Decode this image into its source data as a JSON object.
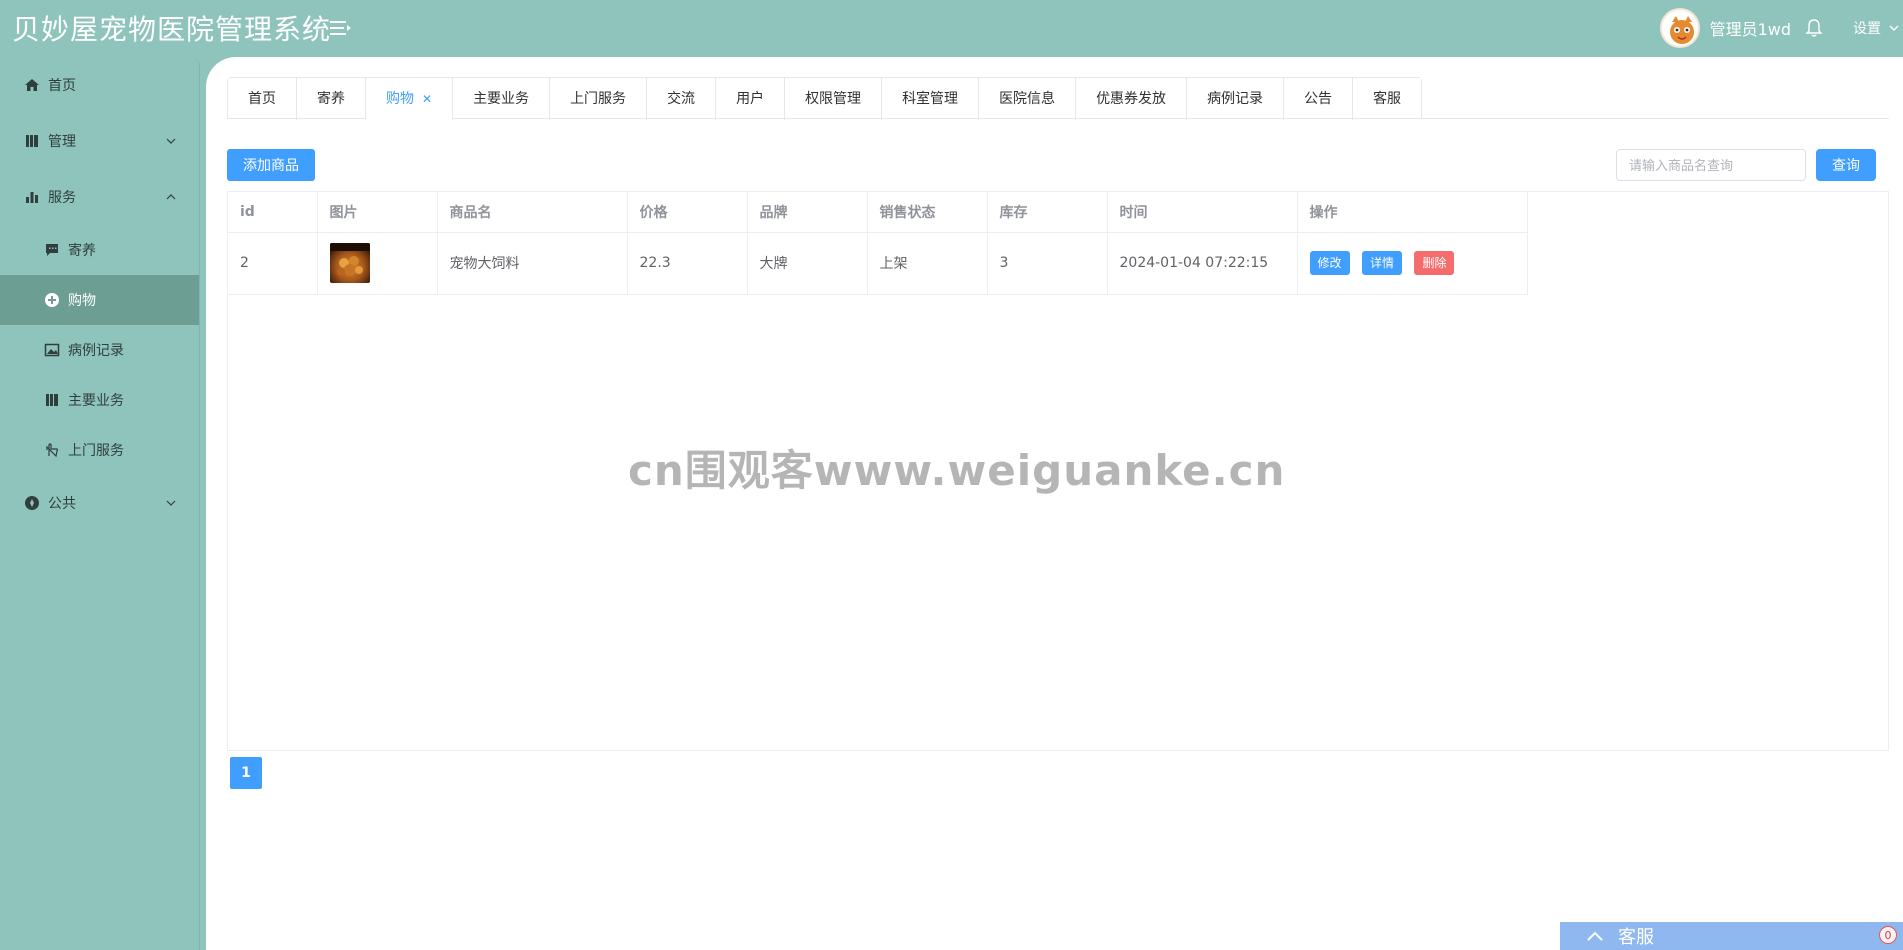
{
  "header": {
    "title": "贝妙屋宠物医院管理系统",
    "user_name": "管理员1wd",
    "settings_label": "设置"
  },
  "sidebar": {
    "items": [
      {
        "label": "首页",
        "icon": "home-icon"
      },
      {
        "label": "管理",
        "icon": "book-icon",
        "expanded": false
      },
      {
        "label": "服务",
        "icon": "bar-chart-icon",
        "expanded": true
      },
      {
        "label": "公共",
        "icon": "compass-icon",
        "expanded": false
      }
    ],
    "service_children": [
      {
        "label": "寄养",
        "icon": "chat-icon"
      },
      {
        "label": "购物",
        "icon": "plus-circle-icon",
        "active": true
      },
      {
        "label": "病例记录",
        "icon": "picture-icon"
      },
      {
        "label": "主要业务",
        "icon": "book-icon"
      },
      {
        "label": "上门服务",
        "icon": "hand-icon"
      }
    ]
  },
  "tabs": [
    "首页",
    "寄养",
    "购物",
    "主要业务",
    "上门服务",
    "交流",
    "用户",
    "权限管理",
    "科室管理",
    "医院信息",
    "优惠券发放",
    "病例记录",
    "公告",
    "客服"
  ],
  "active_tab": "购物",
  "toolbar": {
    "add_label": "添加商品",
    "search_placeholder": "请输入商品名查询",
    "search_label": "查询"
  },
  "table": {
    "columns": [
      "id",
      "图片",
      "商品名",
      "价格",
      "品牌",
      "销售状态",
      "库存",
      "时间",
      "操作"
    ],
    "rows": [
      {
        "id": "2",
        "name": "宠物大饲料",
        "price": "22.3",
        "brand": "大牌",
        "status": "上架",
        "stock": "3",
        "time": "2024-01-04 07:22:15"
      }
    ],
    "actions": {
      "edit": "修改",
      "detail": "详情",
      "delete": "删除"
    }
  },
  "watermark": "cn围观客www.weiguanke.cn",
  "pagination": {
    "current": "1"
  },
  "chat": {
    "label": "客服",
    "unread": "0"
  },
  "colors": {
    "primary": "#409eff",
    "danger": "#f56c6c",
    "sidebar_bg": "#8fc4bc",
    "active_bg": "#6c9e94"
  }
}
